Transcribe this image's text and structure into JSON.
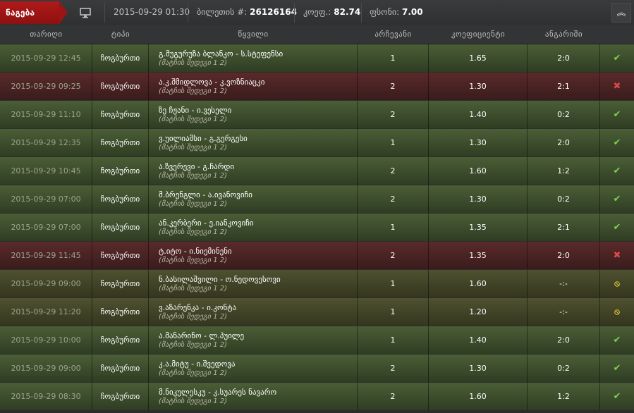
{
  "topbar": {
    "tag_label": "ნაგება",
    "monitor_icon": "monitor-icon",
    "datetime": "2015-09-29 01:30",
    "ticket_label": "ბილეთის #:",
    "ticket_value": "26126164",
    "coef_label": "კოეფ.:",
    "coef_value": "82.74",
    "amount_label": "ფსონი:",
    "amount_value": "7.00",
    "collapse_icon": "chevron-up-double-icon"
  },
  "columns": {
    "date": "თარიღი",
    "type": "ტიპი",
    "match": "წყვილი",
    "choice": "არჩევანი",
    "odds": "კოეფიციენტი",
    "score": "ანგარიში"
  },
  "rows": [
    {
      "status": "win",
      "date": "2015-09-29 12:45",
      "type": "ჩოგბურთი",
      "match": "გ.მუგურუზა ბლანკო - ს.სტეფენსი",
      "sub": "(მატჩის შედეგი 1 2)",
      "choice": "1",
      "odds": "1.65",
      "score": "2:0",
      "icon": "✔"
    },
    {
      "status": "loss",
      "date": "2015-09-29 09:25",
      "type": "ჩოგბურთი",
      "match": "ა.კ.შმიდლოვა - კ.ვოზნიაცკი",
      "sub": "(მატჩის შედეგი 1 2)",
      "choice": "2",
      "odds": "1.30",
      "score": "2:1",
      "icon": "✖"
    },
    {
      "status": "win",
      "date": "2015-09-29 11:10",
      "type": "ჩოგბურთი",
      "match": "ზე ჩჟანი - ი.ვესელი",
      "sub": "(მატჩის შედეგი 1 2)",
      "choice": "2",
      "odds": "1.40",
      "score": "0:2",
      "icon": "✔"
    },
    {
      "status": "win",
      "date": "2015-09-29 12:35",
      "type": "ჩოგბურთი",
      "match": "ვ.უილიამსი - გ.გერგესი",
      "sub": "(მატჩის შედეგი 1 2)",
      "choice": "1",
      "odds": "1.30",
      "score": "2:0",
      "icon": "✔"
    },
    {
      "status": "win",
      "date": "2015-09-29 10:45",
      "type": "ჩოგბურთი",
      "match": "ა.ზვერევი - გ.ჩარდი",
      "sub": "(მატჩის შედეგი 1 2)",
      "choice": "2",
      "odds": "1.60",
      "score": "1:2",
      "icon": "✔"
    },
    {
      "status": "win",
      "date": "2015-09-29 07:00",
      "type": "ჩოგბურთი",
      "match": "მ.ბრენგლი - ა.ივანოვიჩი",
      "sub": "(მატჩის შედეგი 1 2)",
      "choice": "2",
      "odds": "1.30",
      "score": "0:2",
      "icon": "✔"
    },
    {
      "status": "win",
      "date": "2015-09-29 07:00",
      "type": "ჩოგბურთი",
      "match": "ან.კერბერი - ე.იანკოვიჩი",
      "sub": "(მატჩის შედეგი 1 2)",
      "choice": "1",
      "odds": "1.35",
      "score": "2:1",
      "icon": "✔"
    },
    {
      "status": "loss",
      "date": "2015-09-29 11:45",
      "type": "ჩოგბურთი",
      "match": "ტ.იტო - ი.ნიემინენი",
      "sub": "(მატჩის შედეგი 1 2)",
      "choice": "2",
      "odds": "1.35",
      "score": "2:0",
      "icon": "✖"
    },
    {
      "status": "void",
      "date": "2015-09-29 09:00",
      "type": "ჩოგბურთი",
      "match": "ნ.ბასილაშვილი - ო.ნედოვესოვი",
      "sub": "(მატჩის შედეგი 1 2)",
      "choice": "1",
      "odds": "1.60",
      "score": "-:-",
      "icon": "⦸"
    },
    {
      "status": "void",
      "date": "2015-09-29 11:20",
      "type": "ჩოგბურთი",
      "match": "ვ.აზარენკა - ი.კონტა",
      "sub": "(მატჩის შედეგი 1 2)",
      "choice": "1",
      "odds": "1.20",
      "score": "-:-",
      "icon": "⦸"
    },
    {
      "status": "win",
      "date": "2015-09-29 10:00",
      "type": "ჩოგბურთი",
      "match": "ა.მანარინო - ლ.პუილე",
      "sub": "(მატჩის შედეგი 1 2)",
      "choice": "1",
      "odds": "1.40",
      "score": "2:0",
      "icon": "✔"
    },
    {
      "status": "win",
      "date": "2015-09-29 09:00",
      "type": "ჩოგბურთი",
      "match": "კ.ა.მიტუ - ი.შვედოვა",
      "sub": "(მატჩის შედეგი 1 2)",
      "choice": "2",
      "odds": "1.30",
      "score": "0:2",
      "icon": "✔"
    },
    {
      "status": "win",
      "date": "2015-09-29 08:30",
      "type": "ჩოგბურთი",
      "match": "მ.ნიკულესკუ - კ.სუარეს ნავარო",
      "sub": "(მატჩის შედეგი 1 2)",
      "choice": "2",
      "odds": "1.60",
      "score": "1:2",
      "icon": "✔"
    }
  ]
}
